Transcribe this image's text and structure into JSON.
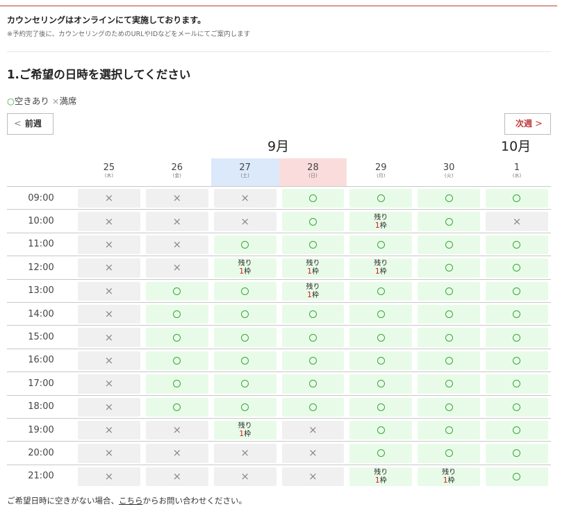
{
  "notice": {
    "title": "カウンセリングはオンラインにて実施しております。",
    "sub": "※予約完了後に、カウンセリングのためのURLやIDなどをメールにてご案内します"
  },
  "section": {
    "title": "1.ご希望の日時を選択してください"
  },
  "legend": {
    "available_symbol": "○",
    "available": "空きあり",
    "full_symbol": "×",
    "full": "満席"
  },
  "nav": {
    "prev": "前週",
    "next": "次週",
    "prev_icon": "chevron-left-icon",
    "next_icon": "chevron-right-icon"
  },
  "months": [
    "9月",
    "10月"
  ],
  "days": [
    {
      "date": "25",
      "weekday": "(木)"
    },
    {
      "date": "26",
      "weekday": "(金)"
    },
    {
      "date": "27",
      "weekday": "(土)"
    },
    {
      "date": "28",
      "weekday": "(日)"
    },
    {
      "date": "29",
      "weekday": "(月)"
    },
    {
      "date": "30",
      "weekday": "(火)"
    },
    {
      "date": "1",
      "weekday": "(水)"
    }
  ],
  "remaining_label": {
    "prefix": "残り",
    "count": "1",
    "suffix": "枠"
  },
  "schedule": [
    {
      "time": "09:00",
      "slots": [
        "x",
        "x",
        "x",
        "o",
        "o",
        "o",
        "o"
      ]
    },
    {
      "time": "10:00",
      "slots": [
        "x",
        "x",
        "x",
        "o",
        "r",
        "o",
        "x"
      ]
    },
    {
      "time": "11:00",
      "slots": [
        "x",
        "x",
        "o",
        "o",
        "o",
        "o",
        "o"
      ]
    },
    {
      "time": "12:00",
      "slots": [
        "x",
        "x",
        "r",
        "r",
        "r",
        "o",
        "o"
      ]
    },
    {
      "time": "13:00",
      "slots": [
        "x",
        "o",
        "o",
        "r",
        "o",
        "o",
        "o"
      ]
    },
    {
      "time": "14:00",
      "slots": [
        "x",
        "o",
        "o",
        "o",
        "o",
        "o",
        "o"
      ]
    },
    {
      "time": "15:00",
      "slots": [
        "x",
        "o",
        "o",
        "o",
        "o",
        "o",
        "o"
      ]
    },
    {
      "time": "16:00",
      "slots": [
        "x",
        "o",
        "o",
        "o",
        "o",
        "o",
        "o"
      ]
    },
    {
      "time": "17:00",
      "slots": [
        "x",
        "o",
        "o",
        "o",
        "o",
        "o",
        "o"
      ]
    },
    {
      "time": "18:00",
      "slots": [
        "x",
        "o",
        "o",
        "o",
        "o",
        "o",
        "o"
      ]
    },
    {
      "time": "19:00",
      "slots": [
        "x",
        "x",
        "r",
        "x",
        "o",
        "o",
        "o"
      ]
    },
    {
      "time": "20:00",
      "slots": [
        "x",
        "x",
        "x",
        "x",
        "o",
        "o",
        "o"
      ]
    },
    {
      "time": "21:00",
      "slots": [
        "x",
        "x",
        "x",
        "x",
        "r",
        "r",
        "o"
      ]
    }
  ],
  "footer": {
    "before": "ご希望日時に空きがない場合、",
    "link": "こちら",
    "after": "からお問い合わせください。"
  },
  "colors": {
    "accent": "#c0393b",
    "available_bg": "#e8fbe8",
    "full_bg": "#f0f0f0",
    "circle": "#3aa53a",
    "remaining_num": "#d02020",
    "saturday_bg": "#dce9fb",
    "sunday_bg": "#fbdcdc"
  }
}
